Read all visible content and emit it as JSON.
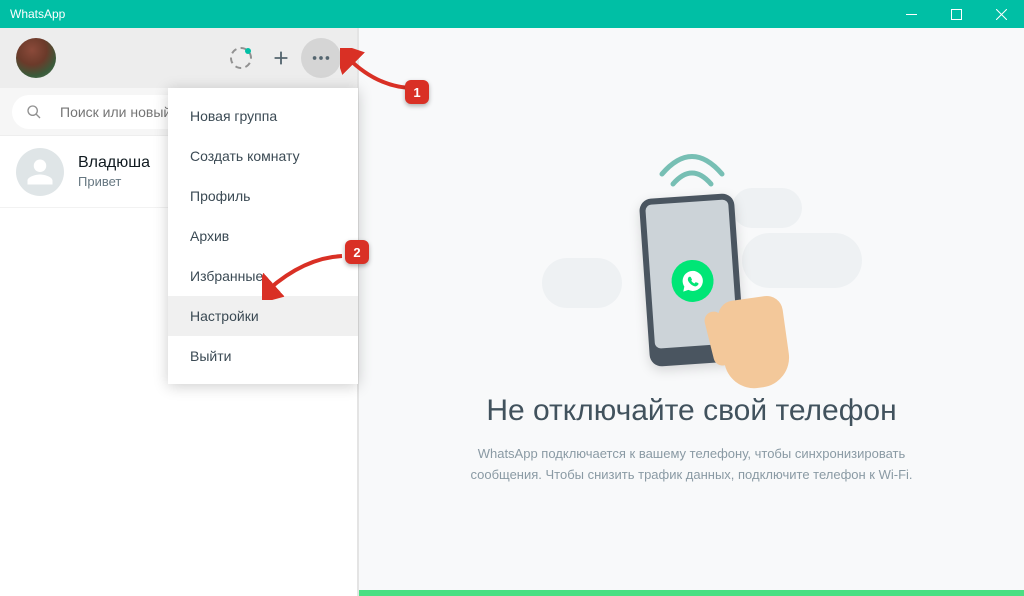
{
  "titlebar": {
    "app_name": "WhatsApp"
  },
  "sidebar": {
    "search_placeholder": "Поиск или новый чат",
    "chats": [
      {
        "name": "Владюша",
        "preview": "Привет"
      }
    ]
  },
  "dropdown": {
    "items": [
      "Новая группа",
      "Создать комнату",
      "Профиль",
      "Архив",
      "Избранные",
      "Настройки",
      "Выйти"
    ],
    "highlighted_index": 5
  },
  "main": {
    "title": "Не отключайте свой телефон",
    "text": "WhatsApp подключается к вашему телефону, чтобы синхронизировать сообщения. Чтобы снизить трафик данных, подключите телефон к Wi-Fi."
  },
  "callouts": {
    "one": "1",
    "two": "2"
  },
  "colors": {
    "accent": "#00bfa5",
    "danger": "#d93025"
  }
}
